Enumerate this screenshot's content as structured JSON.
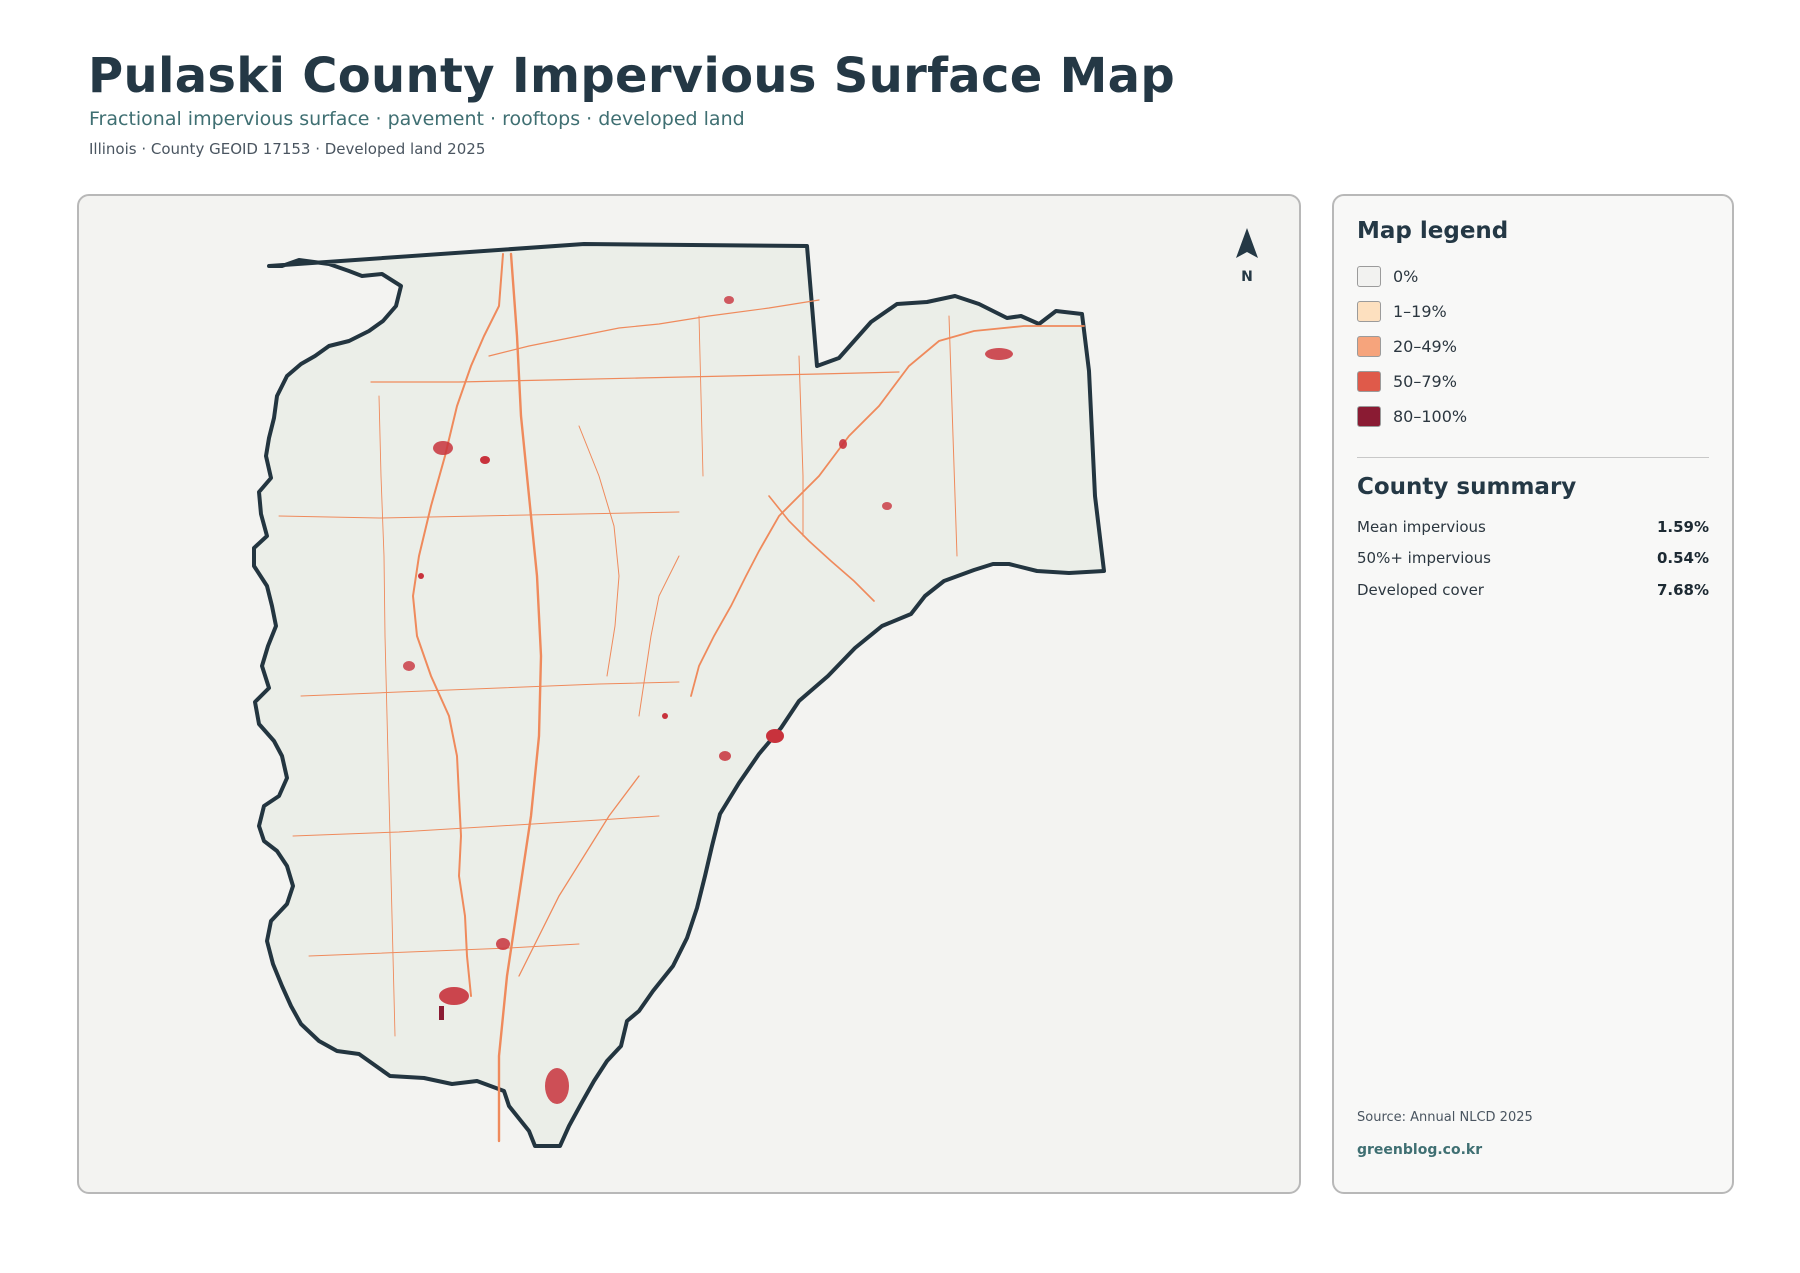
{
  "header": {
    "title": "Pulaski County Impervious Surface Map",
    "subtitle": "Fractional impervious surface · pavement · rooftops · developed land",
    "meta": "Illinois · County GEOID 17153 · Developed land 2025"
  },
  "map": {
    "north_label": "N",
    "fill_color": "#ebeee8",
    "outline_color": "#233540",
    "road_color": "#ef8a5c",
    "urban_color": "#c8323c"
  },
  "legend": {
    "title": "Map legend",
    "items": [
      {
        "label": "0%",
        "color": "#f2f2f0"
      },
      {
        "label": "1–19%",
        "color": "#fde0bf"
      },
      {
        "label": "20–49%",
        "color": "#f6a47c"
      },
      {
        "label": "50–79%",
        "color": "#df5a4a"
      },
      {
        "label": "80–100%",
        "color": "#8a1b33"
      }
    ]
  },
  "summary": {
    "title": "County summary",
    "rows": [
      {
        "label": "Mean impervious",
        "value": "1.59%"
      },
      {
        "label": "50%+ impervious",
        "value": "0.54%"
      },
      {
        "label": "Developed cover",
        "value": "7.68%"
      }
    ]
  },
  "footer": {
    "source": "Source: Annual NLCD 2025",
    "site": "greenblog.co.kr"
  }
}
